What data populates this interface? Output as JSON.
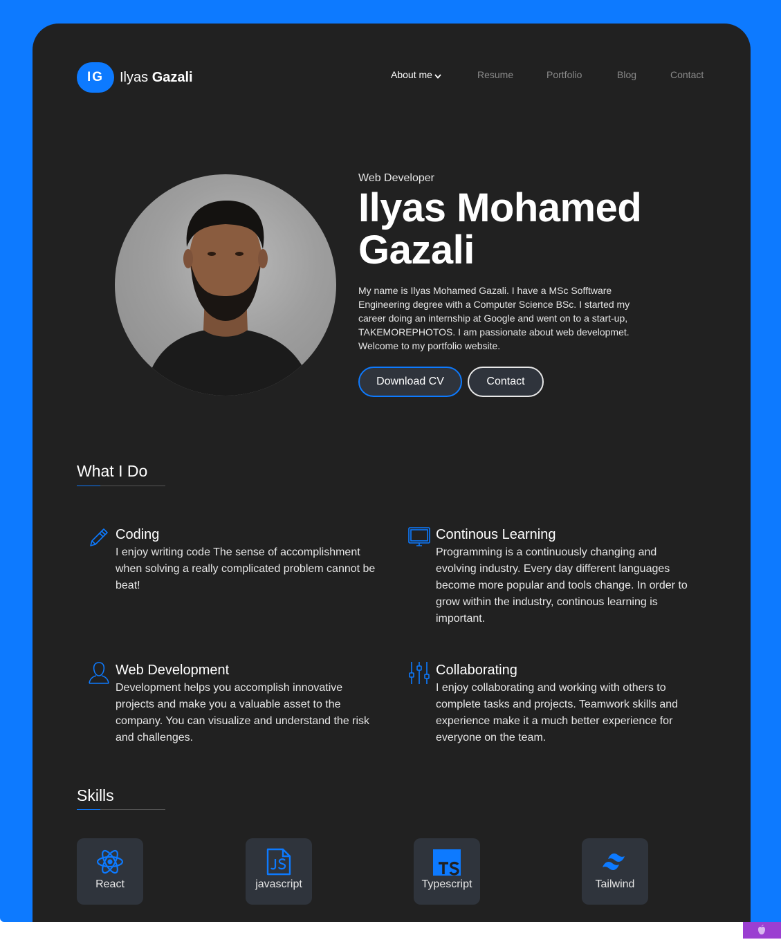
{
  "colors": {
    "accent": "#0d7aff",
    "card": "#212121",
    "tile": "#2f343c"
  },
  "brand": {
    "initials": "IG",
    "first_name": "Ilyas",
    "last_name": "Gazali"
  },
  "nav": {
    "items": [
      {
        "label": "About me",
        "active": true
      },
      {
        "label": "Resume",
        "active": false
      },
      {
        "label": "Portfolio",
        "active": false
      },
      {
        "label": "Blog",
        "active": false
      },
      {
        "label": "Contact",
        "active": false
      }
    ]
  },
  "hero": {
    "role": "Web Developer",
    "name": "Ilyas Mohamed Gazali",
    "bio": "My name is Ilyas Mohamed Gazali. I have a MSc Sofftware Engineering degree with a Computer Science BSc. I started my career doing an internship at Google and went on to a start-up, TAKEMOREPHOTOS. I am passionate about web developmet. Welcome to my portfolio website.",
    "download_cv_label": "Download CV",
    "contact_label": "Contact"
  },
  "what_i_do": {
    "title": "What I Do",
    "items": [
      {
        "icon": "pencil-icon",
        "title": "Coding",
        "text": "I enjoy writing code The sense of accomplishment when solving a really complicated problem cannot be beat!"
      },
      {
        "icon": "monitor-icon",
        "title": "Continous Learning",
        "text": "Programming is a continuously changing and evolving industry. Every day different languages become more popular and tools change. In order to grow within the industry, continous learning is important."
      },
      {
        "icon": "user-icon",
        "title": "Web Development",
        "text": "Development helps you accomplish innovative projects and make you a valuable asset to the company. You can visualize and understand the risk and challenges."
      },
      {
        "icon": "sliders-icon",
        "title": "Collaborating",
        "text": "I enjoy collaborating and working with others to complete tasks and projects. Teamwork skills and experience make it a much better experience for everyone on the team."
      }
    ]
  },
  "skills": {
    "title": "Skills",
    "items": [
      {
        "icon": "react-icon",
        "label": "React"
      },
      {
        "icon": "javascript-icon",
        "label": "javascript"
      },
      {
        "icon": "typescript-icon",
        "label": "Typescript"
      },
      {
        "icon": "tailwind-icon",
        "label": "Tailwind"
      }
    ]
  }
}
